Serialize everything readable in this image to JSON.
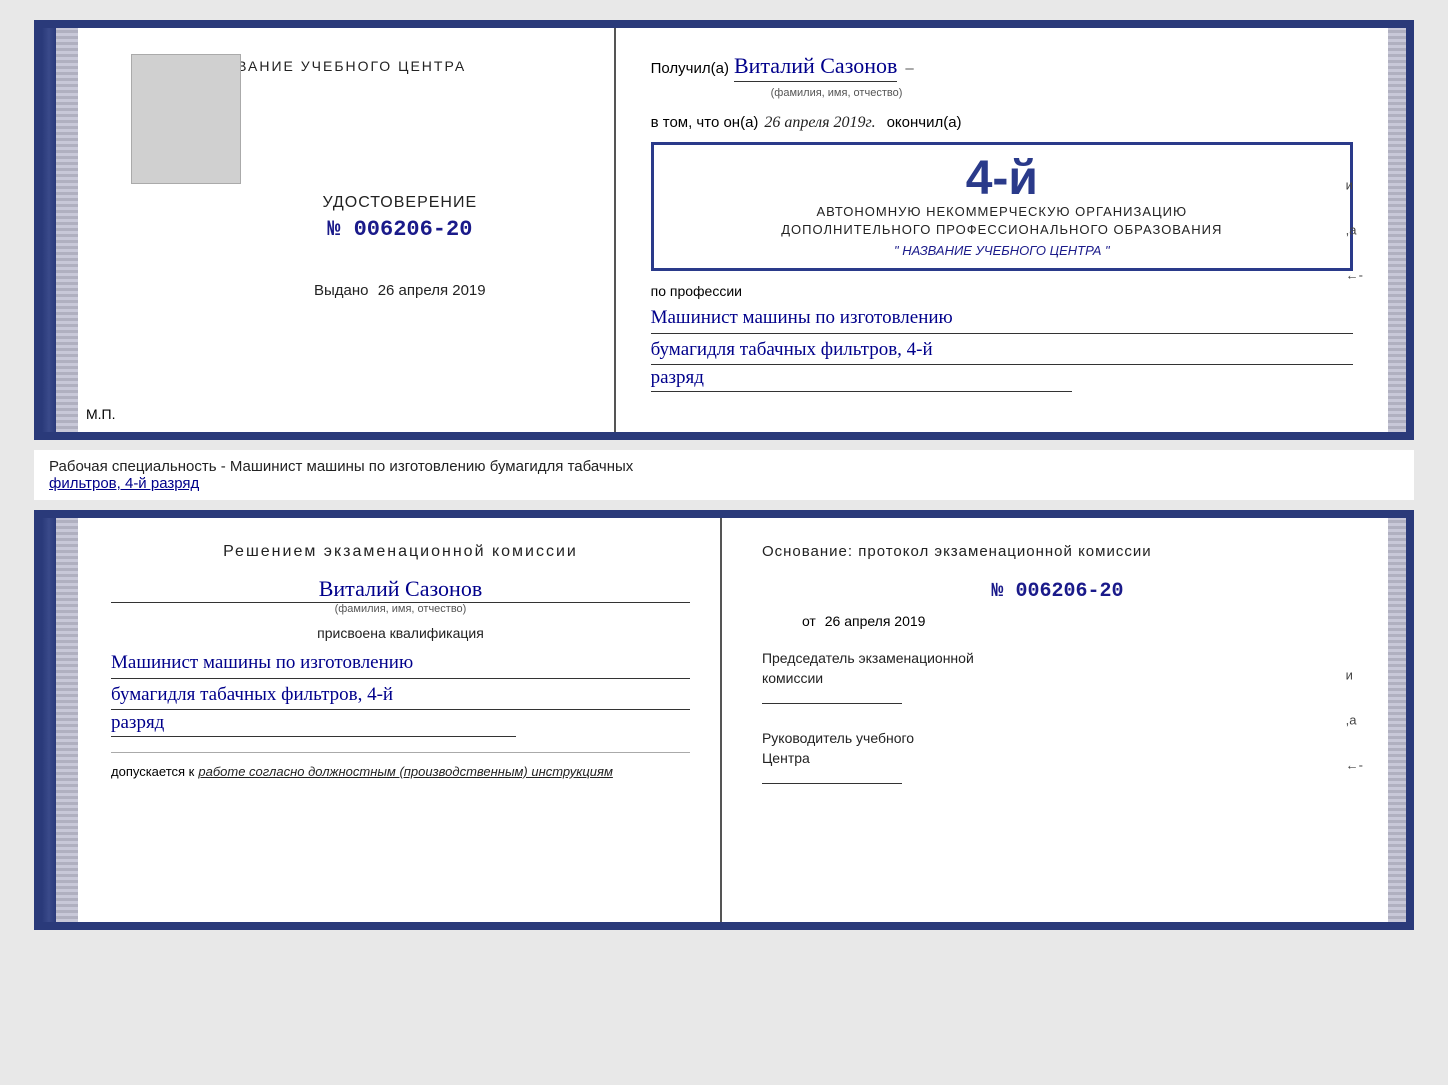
{
  "topCert": {
    "left": {
      "schoolNameLabel": "НАЗВАНИЕ УЧЕБНОГО ЦЕНТРА",
      "udostoverenie": "УДОСТОВЕРЕНИЕ",
      "number": "№ 006206-20",
      "vydano": "Выдано",
      "vydanoDate": "26 апреля 2019",
      "mp": "М.П."
    },
    "right": {
      "poluchil": "Получил(а)",
      "handwrittenName": "Виталий Сазонов",
      "fioLabel": "(фамилия, имя, отчество)",
      "dash": "–",
      "vTomChto": "в том, что он(а)",
      "date": "26 апреля 2019г.",
      "okonchil": "окончил(а)",
      "stampNumber": "4-й",
      "stampLine1": "АВТОНОМНУЮ НЕКОММЕРЧЕСКУЮ ОРГАНИЗАЦИЮ",
      "stampLine2": "ДОПОЛНИТЕЛЬНОГО ПРОФЕССИОНАЛЬНОГО ОБРАЗОВАНИЯ",
      "stampLine3": "\" НАЗВАНИЕ УЧЕБНОГО ЦЕНТРА \"",
      "poProfessii": "по профессии",
      "profession1": "Машинист машины по изготовлению",
      "profession2": "бумагидля табачных фильтров, 4-й",
      "razryad": "разряд"
    }
  },
  "middleStrip": {
    "text": "Рабочая специальность - Машинист машины по изготовлению бумагидля табачных",
    "underlined": "фильтров, 4-й разряд"
  },
  "bottomCert": {
    "left": {
      "resheniyem": "Решением  экзаменационной  комиссии",
      "handwrittenName": "Виталий Сазонов",
      "fioLabel": "(фамилия, имя, отчество)",
      "prisvoena": "присвоена квалификация",
      "profession1": "Машинист машины по изготовлению",
      "profession2": "бумагидля табачных фильтров, 4-й",
      "razryad": "разряд",
      "dopuskaetsya": "допускается к",
      "dopuskaetsyaItalic": "работе согласно должностным (производственным) инструкциям"
    },
    "right": {
      "osnovanie": "Основание: протокол экзаменационной  комиссии",
      "number": "№  006206-20",
      "ot": "от",
      "date": "26 апреля 2019",
      "predsedatel1": "Председатель экзаменационной",
      "predsedatel2": "комиссии",
      "rukovoditel1": "Руководитель учебного",
      "rukovoditel2": "Центра"
    }
  }
}
